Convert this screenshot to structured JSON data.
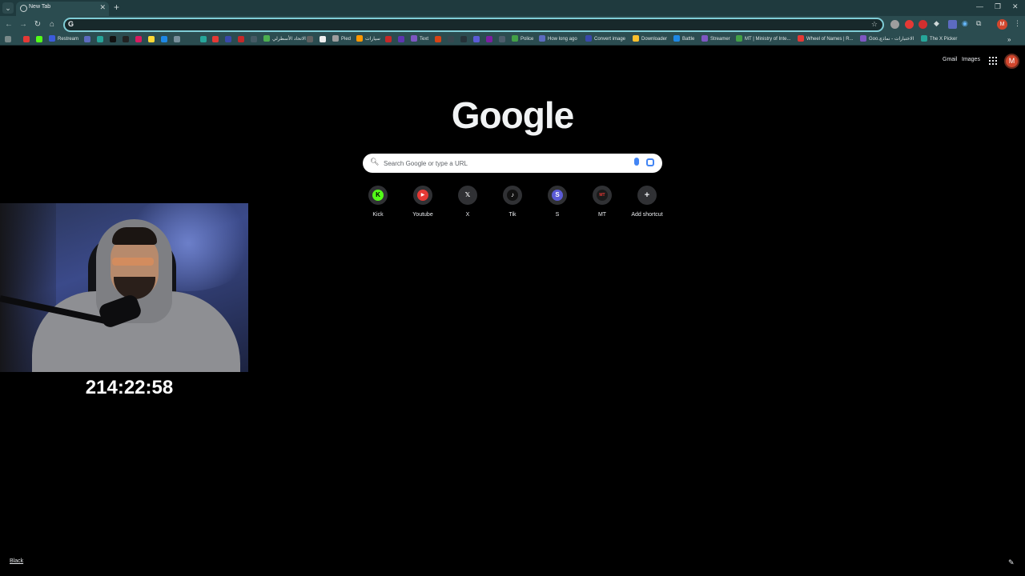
{
  "browser": {
    "tab": {
      "title": "New Tab"
    },
    "omnibox": {
      "value": "",
      "placeholder": ""
    },
    "bookmarks": [
      {
        "label": "Restream",
        "color": "#3b5bdb"
      },
      {
        "label": "الاتحاد الأسطرلي",
        "color": "#4caf50"
      },
      {
        "label": "Pied",
        "color": "#9e9e9e"
      },
      {
        "label": "سيارات",
        "color": "#ff9800"
      },
      {
        "label": "Text",
        "color": "#7e57c2"
      },
      {
        "label": "Police",
        "color": "#43a047"
      },
      {
        "label": "How long ago",
        "color": "#5c6bc0"
      },
      {
        "label": "Convert image",
        "color": "#3949ab"
      },
      {
        "label": "Downloader",
        "color": "#fbc02d"
      },
      {
        "label": "Battle",
        "color": "#1e88e5"
      },
      {
        "label": "Streamer",
        "color": "#7e57c2"
      },
      {
        "label": "MT | Ministry of Inte...",
        "color": "#43a047"
      },
      {
        "label": "Wheel of Names | R...",
        "color": "#e53935"
      },
      {
        "label": "Goo...",
        "color": "#7e57c2"
      },
      {
        "label": "الاختبارات - نماذج",
        "color": "#7e57c2"
      },
      {
        "label": "The X Picker",
        "color": "#26a69a"
      }
    ]
  },
  "ntp": {
    "links": {
      "gmail": "Gmail",
      "images": "Images"
    },
    "avatar_letter": "M",
    "logo": "Google",
    "search_placeholder": "Search Google or type a URL",
    "shortcuts": [
      {
        "label": "Kick",
        "glyph": "K",
        "color": "#53fc18",
        "text": "#000"
      },
      {
        "label": "Youtube",
        "glyph": "▶",
        "color": "#e53935",
        "text": "#fff"
      },
      {
        "label": "X",
        "glyph": "𝕏",
        "color": "#303134",
        "text": "#fff"
      },
      {
        "label": "Tik",
        "glyph": "♪",
        "color": "#111111",
        "text": "#fff"
      },
      {
        "label": "S",
        "glyph": "S",
        "color": "#5b5bd6",
        "text": "#fff"
      },
      {
        "label": "MT",
        "glyph": "MT",
        "color": "#1a1a1a",
        "text": "#e53935"
      },
      {
        "label": "Add shortcut",
        "glyph": "+",
        "color": "#303134",
        "text": "#e8eaed"
      }
    ],
    "bottom_link": "Black"
  },
  "overlay": {
    "timer": "214:22:58"
  }
}
